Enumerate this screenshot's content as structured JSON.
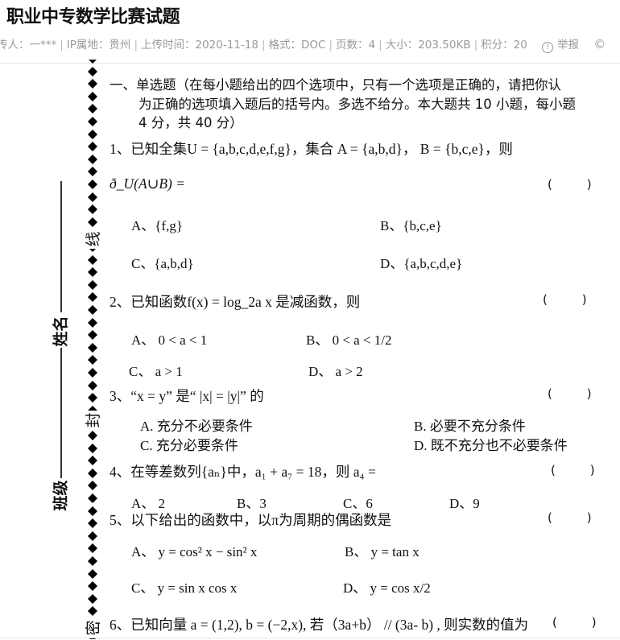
{
  "header": {
    "title": "职业中专数学比赛试题",
    "meta": {
      "uploader": "传人：一***",
      "ip_location": "IP属地：贵州",
      "upload_time": "上传时间：2020-11-18",
      "format": "格式：DOC",
      "pages": "页数：4",
      "size": "大小：203.50KB",
      "points": "积分：20",
      "report_label": "举报",
      "report_icon": "info-circle-icon",
      "copyright_icon": "©"
    }
  },
  "binding": {
    "chars": [
      "线",
      "封",
      "密"
    ],
    "labels": [
      "姓名",
      "班级"
    ]
  },
  "section": {
    "heading_line1": "一、单选题（在每小题给出的四个选项中，只有一个选项是正确的，请把你认",
    "heading_line2": "为正确的选项填入题后的括号内。多选不给分。本大题共 10 小题，每小题",
    "heading_line3": "4 分，共 40 分）"
  },
  "questions": [
    {
      "number": "1、",
      "stem": "已知全集U = {a,b,c,d,e,f,g}，集合 A = {a,b,d}， B = {b,c,e}，则",
      "stem2": "ð_U(A∪B) =",
      "paren": "(         )",
      "options": [
        "A、{f,g}",
        "B、{b,c,e}",
        "C、{a,b,d}",
        "D、{a,b,c,d,e}"
      ]
    },
    {
      "number": "2、",
      "stem": "已知函数f(x) = log_2a x 是减函数，则",
      "paren": "(         )",
      "options": [
        "A、  0 < a < 1",
        "B、  0 < a < 1/2",
        "C、  a > 1",
        "D、 a > 2"
      ]
    },
    {
      "number": "3、",
      "stem": "“x = y” 是“ |x| = |y|” 的",
      "paren": "(         )",
      "options": [
        "A. 充分不必要条件",
        "B. 必要不充分条件",
        "C. 充分必要条件",
        "D. 既不充分也不必要条件"
      ]
    },
    {
      "number": "4、",
      "stem": "在等差数列{aₙ}中，a₁ + a₇ = 18，则 a₄ =",
      "paren": "(         )",
      "options": [
        "A、  2",
        "B、3",
        "C、6",
        "D、9"
      ]
    },
    {
      "number": "5、",
      "stem": "以下给出的函数中，以π为周期的偶函数是",
      "paren": "(         )",
      "options": [
        "A、 y = cos² x − sin² x",
        "B、 y = tan x",
        "C、 y = sin x cos x",
        "D、 y = cos x/2"
      ]
    },
    {
      "number": "6、",
      "stem": "已知向量 a = (1,2), b = (−2,x), 若（3a+b） // (3a- b) , 则实数的值为",
      "paren": "(         )"
    }
  ]
}
